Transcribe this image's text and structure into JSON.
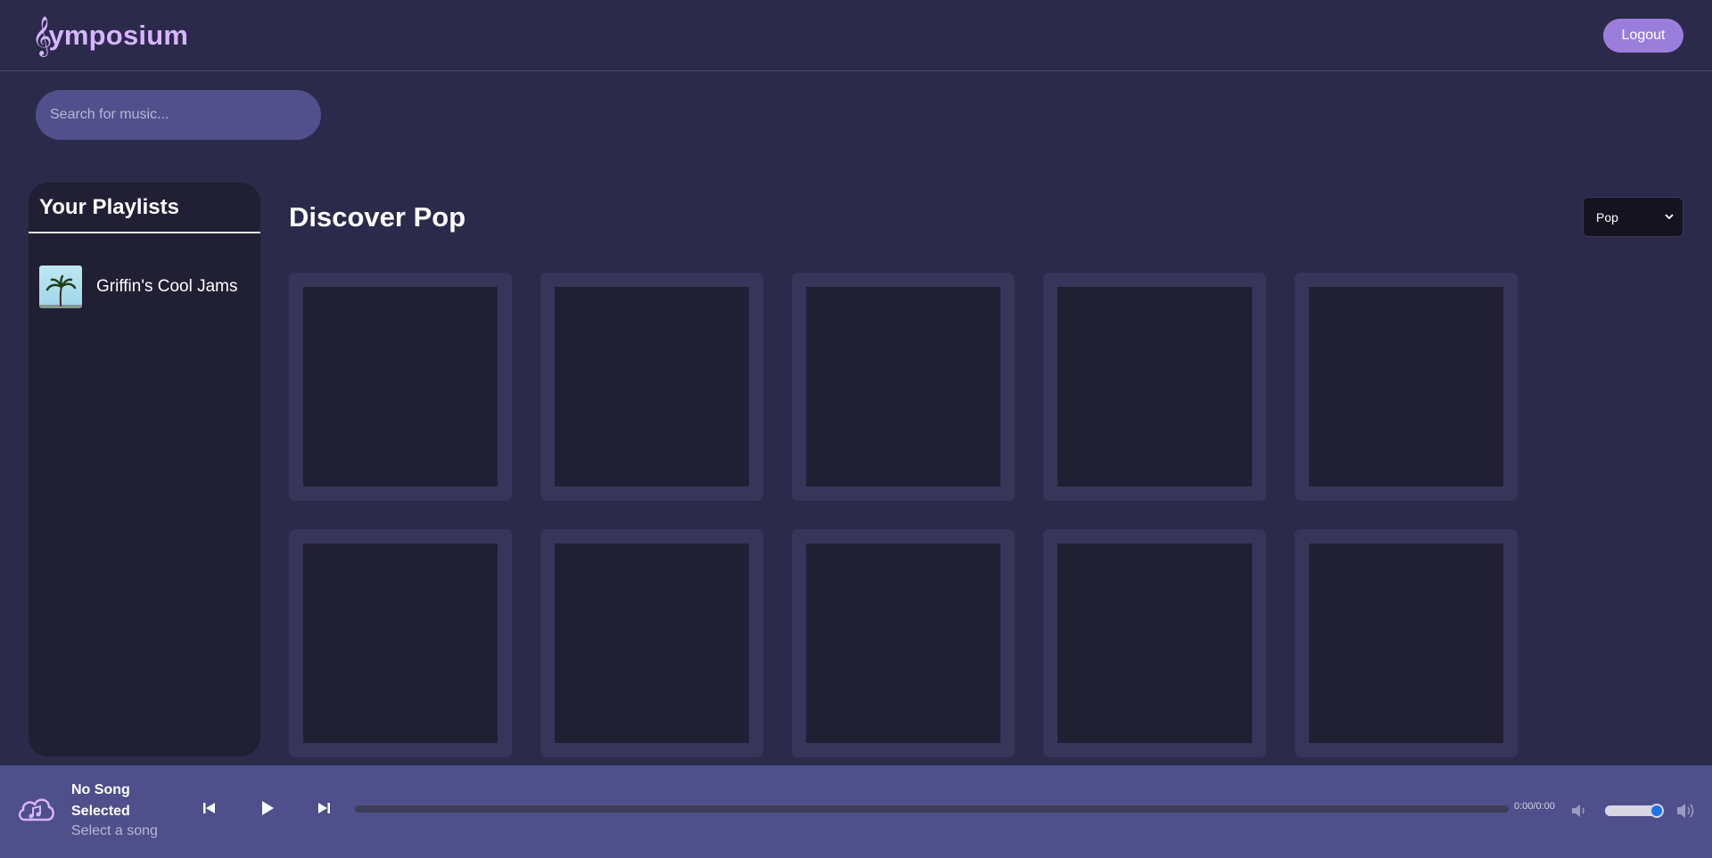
{
  "app": {
    "logo_symbol": "𝄞",
    "logo_text": "ymposium",
    "accent_color": "#d7b5ff",
    "logout_label": "Logout"
  },
  "search": {
    "placeholder": "Search for music..."
  },
  "sidebar": {
    "title": "Your Playlists",
    "playlists": [
      {
        "name": "Griffin's Cool Jams",
        "thumb_icon": "palm-tree-icon"
      }
    ]
  },
  "main": {
    "title": "Discover Pop",
    "genre_selected": "Pop",
    "card_count": 10
  },
  "player": {
    "song_title": "No Song Selected",
    "song_subtitle": "Select a song",
    "time": "0:00/0:00",
    "progress": 0,
    "volume": 1.0,
    "icons": {
      "cloud": "cloud-music-icon",
      "prev": "skip-previous-icon",
      "play": "play-icon",
      "next": "skip-next-icon",
      "mute": "volume-low-icon",
      "loud": "volume-high-icon"
    }
  }
}
